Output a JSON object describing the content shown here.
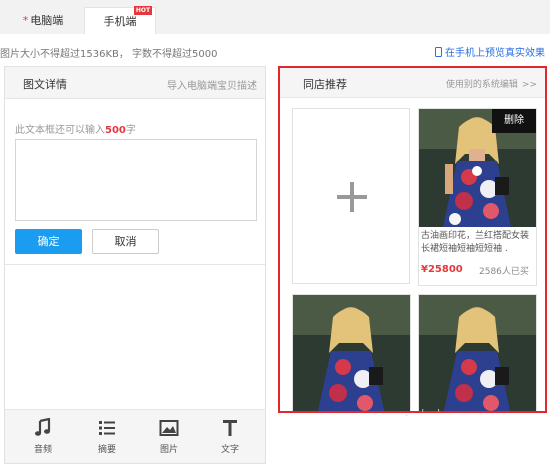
{
  "tabs": {
    "pc": {
      "required_mark": "*",
      "label": "电脑端"
    },
    "mobile": {
      "label": "手机端",
      "badge": "HOT"
    }
  },
  "limits_text": "图片大小不得超过1536KB， 字数不得超过5000",
  "preview_link": "在手机上预览真实效果",
  "left_panel": {
    "title": "图文详情",
    "import_link": "导入电脑端宝贝描述",
    "hint_prefix": "此文本框还可以输入",
    "hint_count": "500",
    "hint_suffix": "字",
    "textarea_value": "",
    "ok_button": "确定",
    "cancel_button": "取消",
    "toolbar": [
      {
        "icon": "music-note-icon",
        "label": "音频"
      },
      {
        "icon": "list-icon",
        "label": "摘要"
      },
      {
        "icon": "image-icon",
        "label": "图片"
      },
      {
        "icon": "text-icon",
        "label": "文字"
      }
    ]
  },
  "right_panel": {
    "title": "同店推荐",
    "link": "使用别的系统编辑",
    "link_chevron": ">>",
    "add_icon": "plus-icon",
    "product": {
      "delete_label": "删除",
      "title": "古油画印花，兰红搭配女装长裙短袖短袖短短袖 .",
      "price": "¥25800",
      "sold": "2586人已买"
    }
  },
  "faint_text": " .  '   '",
  "colors": {
    "accent_red": "#e0282e",
    "primary_blue": "#1a9cf0",
    "link_blue": "#2d6ee0"
  }
}
